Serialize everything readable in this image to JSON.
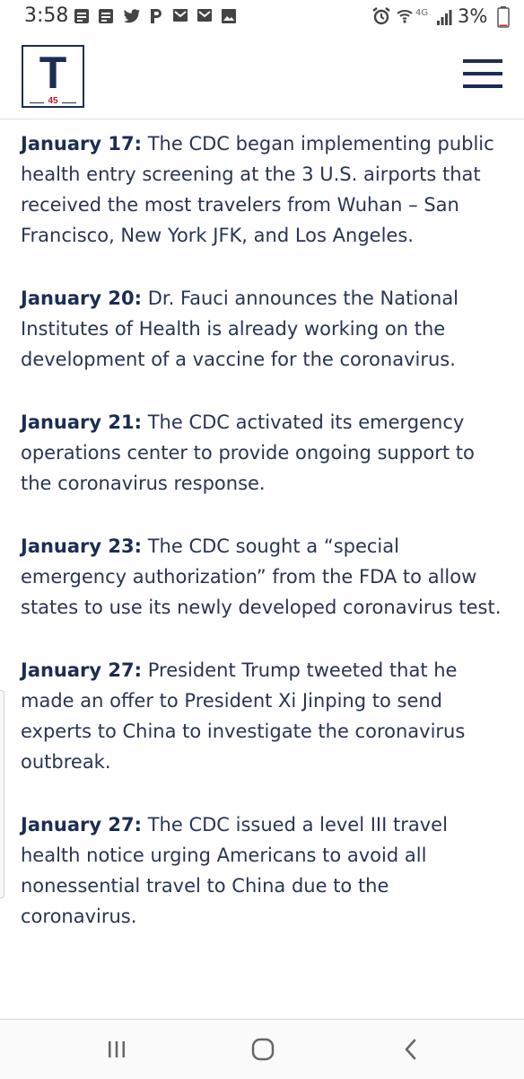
{
  "status_bar": {
    "time": "3:58",
    "notification_icons": [
      "message-icon",
      "message-icon",
      "twitter-icon",
      "pandora-icon",
      "gmail-icon",
      "gmail-icon",
      "image-icon"
    ],
    "system_icons": [
      "alarm-icon",
      "wifi-calling-icon",
      "4g-icon",
      "signal-icon"
    ],
    "network": "4G",
    "battery": "3%",
    "battery_level": 0.03
  },
  "header": {
    "logo_letter": "T",
    "logo_number": "45",
    "menu_icon": "hamburger-menu-icon",
    "brand_color": "#1c2d54",
    "accent_color": "#c8102e"
  },
  "entries": [
    {
      "date": "January 17:",
      "text": " The CDC began implementing public health entry screening at the 3 U.S. airports that received the most travelers from Wuhan – San Francisco, New York JFK, and Los Angeles."
    },
    {
      "date": "January 20:",
      "text": " Dr. Fauci announces the National Institutes of Health is already working on the development of a vaccine for the coronavirus."
    },
    {
      "date": "January 21:",
      "text": " The CDC activated its emergency operations center to provide ongoing support to the coronavirus response."
    },
    {
      "date": "January 23:",
      "text": " The CDC sought a “special emergency authorization” from the FDA to allow states to use its newly developed coronavirus test."
    },
    {
      "date": "January 27:",
      "text": " President Trump tweeted that he made an offer to President Xi Jinping to send experts to China to investigate the coronavirus outbreak."
    },
    {
      "date": "January 27:",
      "text": " The CDC issued a level III travel health notice urging Americans to avoid all nonessential travel to China due to the coronavirus."
    }
  ],
  "nav_bar": {
    "recents_icon": "recent-apps-icon",
    "home_icon": "home-icon",
    "back_icon": "back-icon"
  }
}
